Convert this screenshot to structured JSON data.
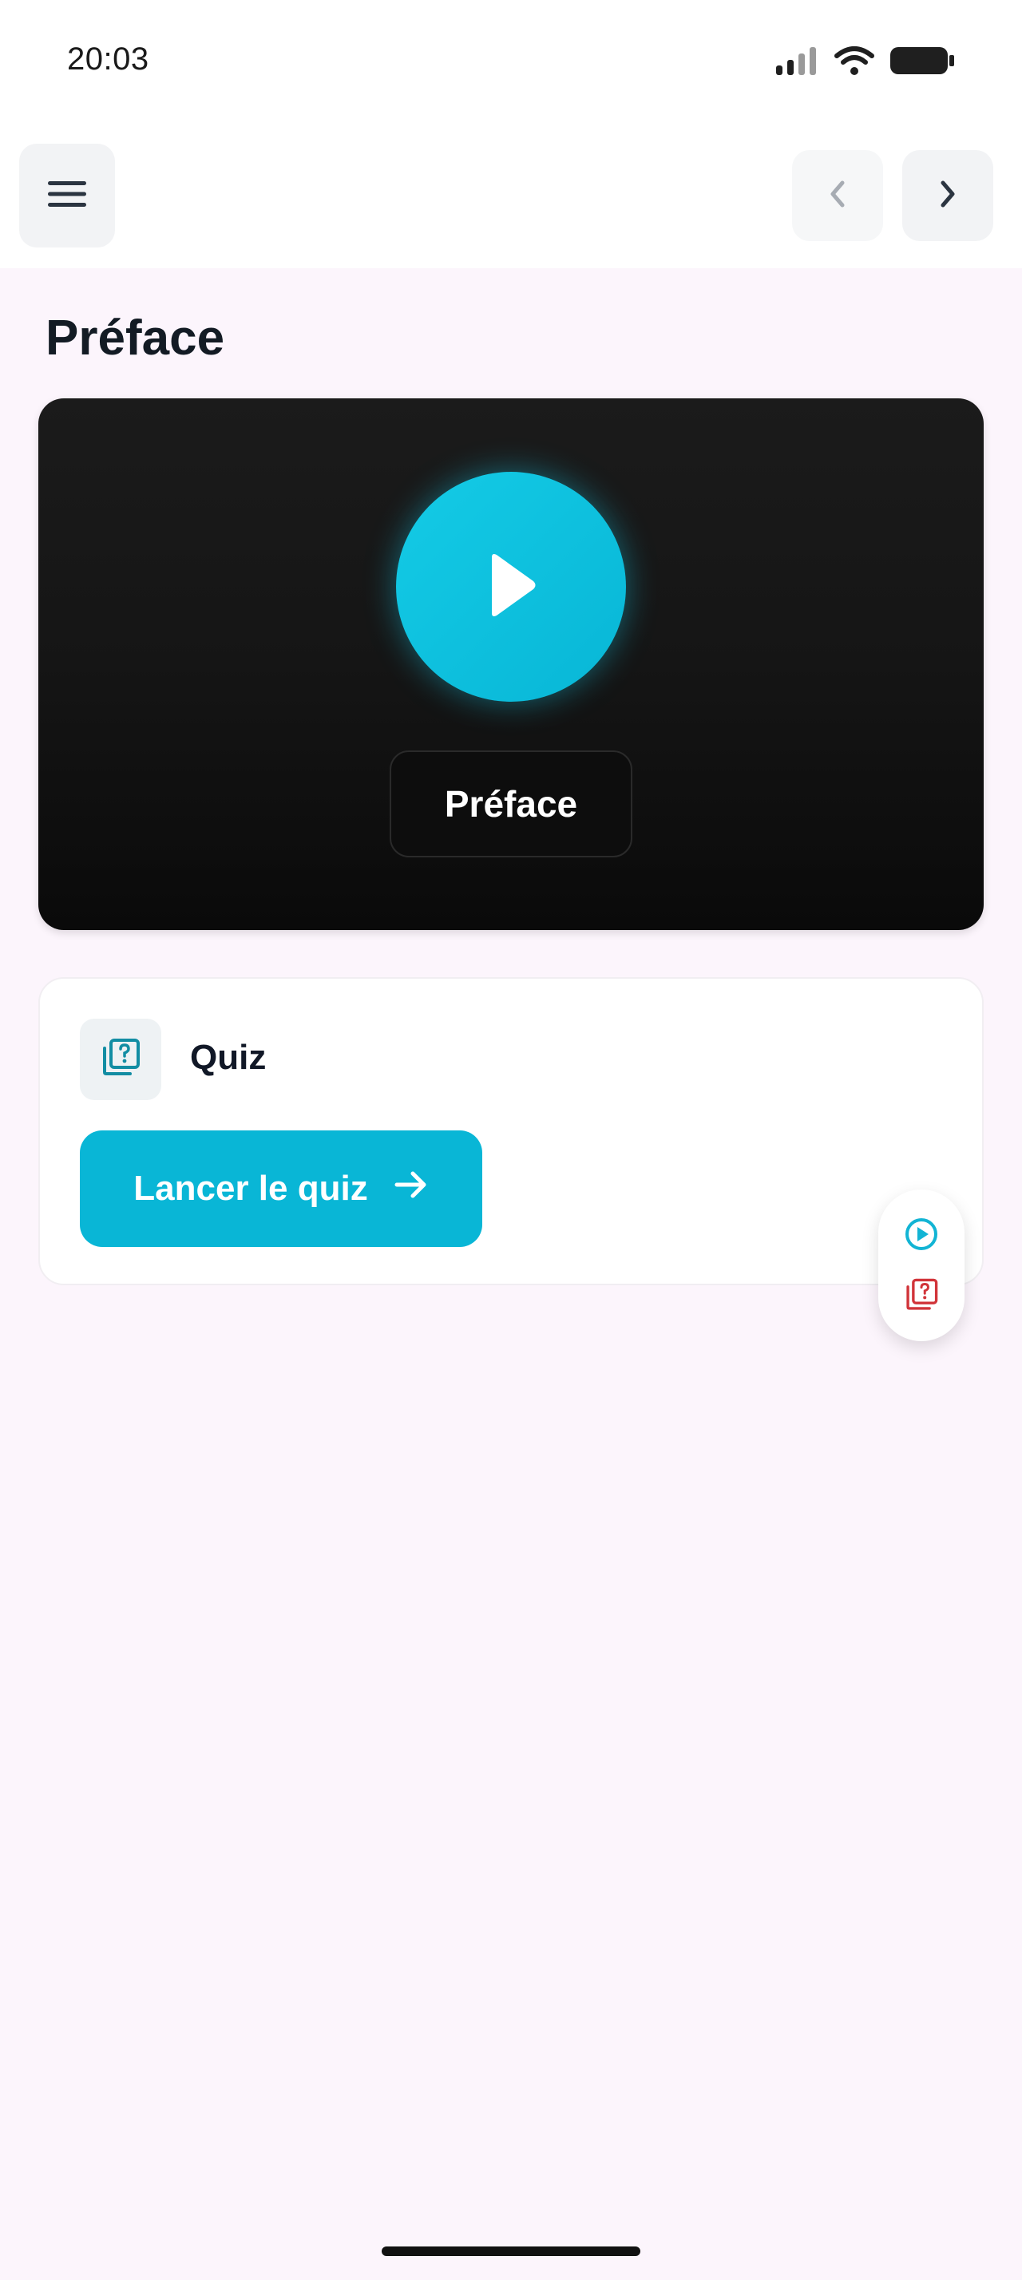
{
  "status_bar": {
    "time": "20:03",
    "icons": [
      "signal-icon",
      "wifi-icon",
      "battery-icon"
    ]
  },
  "top_bar": {
    "menu_icon": "hamburger-menu-icon",
    "prev_icon": "chevron-left-icon",
    "next_icon": "chevron-right-icon"
  },
  "page": {
    "title": "Préface"
  },
  "video": {
    "label": "Préface",
    "play_icon": "play-icon",
    "accent": "#0cc3df"
  },
  "quiz": {
    "title": "Quiz",
    "icon": "quiz-icon",
    "button_label": "Lancer le quiz",
    "button_icon": "arrow-right-icon",
    "accent": "#09b6d6"
  },
  "floating_actions": {
    "video_icon": "play-circle-icon",
    "quiz_icon": "quiz-icon",
    "video_color": "#12b4d4",
    "quiz_color": "#d1343a"
  }
}
